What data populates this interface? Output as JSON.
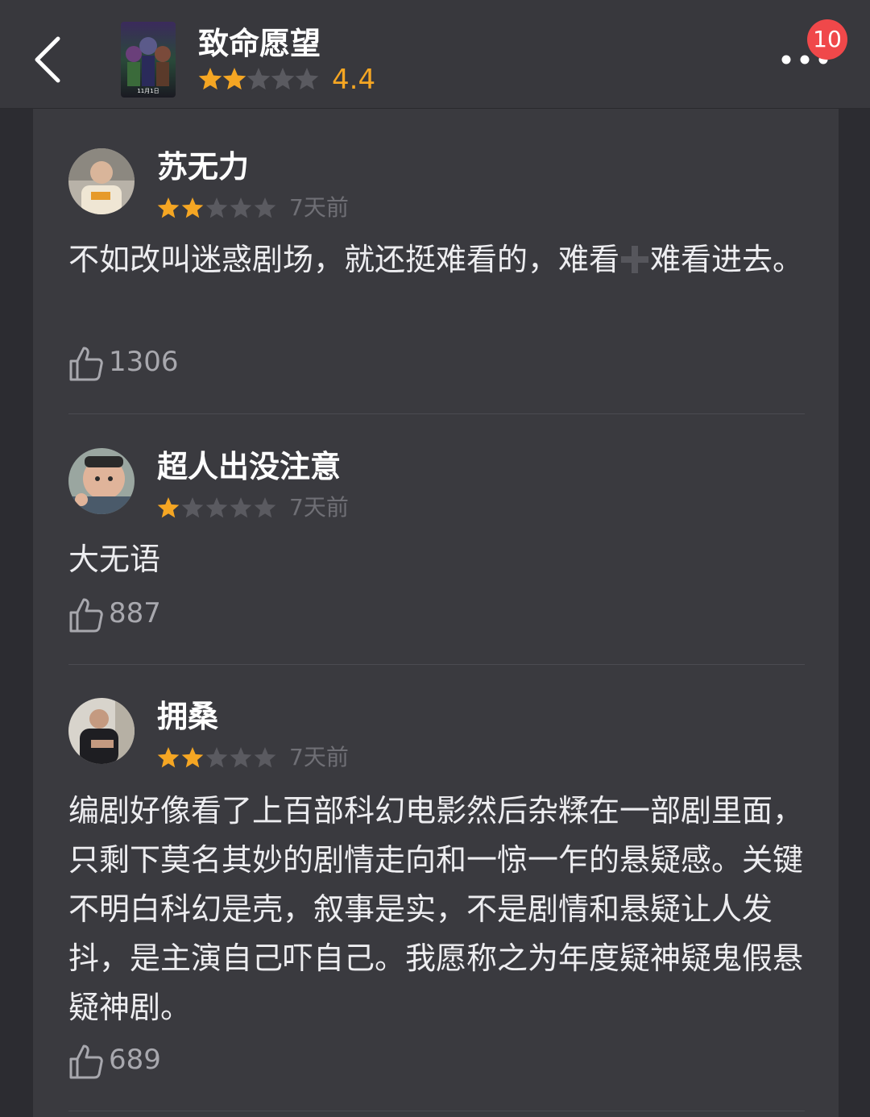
{
  "header": {
    "title": "致命愿望",
    "rating": "4.4",
    "rating_stars": 2,
    "notification_count": "10",
    "poster_text": "11月1日",
    "accent_color": "#f5a623",
    "badge_color": "#f0484a"
  },
  "reviews": [
    {
      "username": "苏无力",
      "stars": 2,
      "time": "7天前",
      "body_before": "不如改叫迷惑剧场，就还挺难看的，难看",
      "body_after": "难看进去。",
      "likes": "1306"
    },
    {
      "username": "超人出没注意",
      "stars": 1,
      "time": "7天前",
      "body": "大无语",
      "likes": "887"
    },
    {
      "username": "拥桑",
      "stars": 2,
      "time": "7天前",
      "body": "编剧好像看了上百部科幻电影然后杂糅在一部剧里面，只剩下莫名其妙的剧情走向和一惊一乍的悬疑感。关键不明白科幻是壳，叙事是实，不是剧情和悬疑让人发抖，是主演自己吓自己。我愿称之为年度疑神疑鬼假悬疑神剧。",
      "likes": "689"
    }
  ],
  "icons": {
    "back": "chevron-left-icon",
    "more": "more-dots-icon",
    "like": "thumbs-up-icon",
    "star": "star-icon"
  }
}
